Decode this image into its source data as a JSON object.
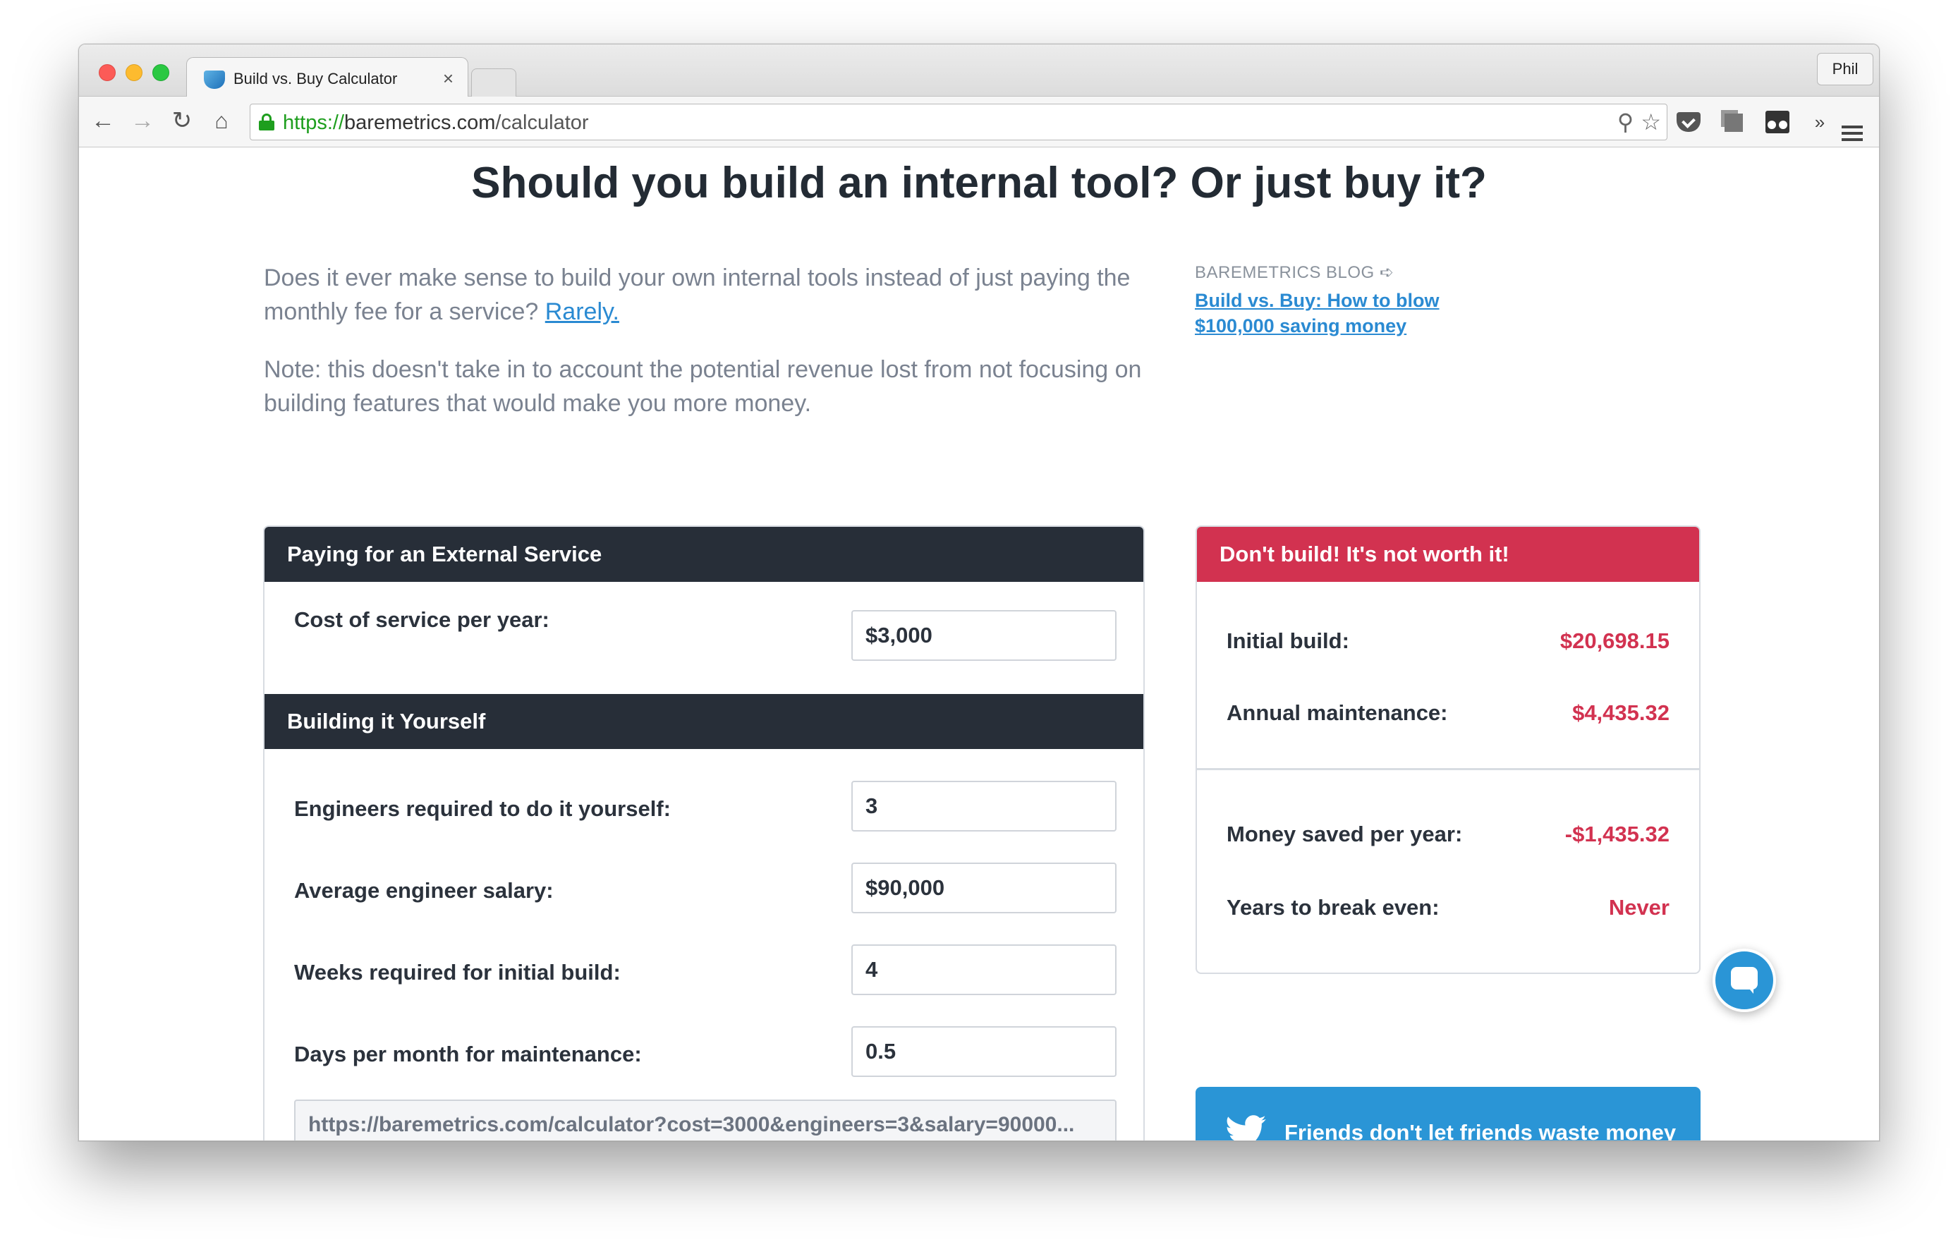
{
  "browser": {
    "tab_title": "Build vs. Buy Calculator",
    "tab_close": "×",
    "profile_name": "Phil",
    "url_scheme": "https://",
    "url_host": "baremetrics.com",
    "url_path": "/calculator"
  },
  "page": {
    "title": "Should you build an internal tool? Or just buy it?",
    "intro_text": "Does it ever make sense to build your own internal tools instead of just paying the monthly fee for a service?",
    "intro_link": "Rarely.",
    "note": "Note: this doesn't take in to account the potential revenue lost from not focusing on building features that would make you more money.",
    "blog_eyebrow": "BAREMETRICS BLOG ➪",
    "blog_link": "Build vs. Buy: How to blow $100,000 saving money"
  },
  "external": {
    "heading": "Paying for an External Service",
    "cost_label": "Cost of service per year:",
    "cost_value": "$3,000"
  },
  "build": {
    "heading": "Building it Yourself",
    "engineers_label": "Engineers required to do it yourself:",
    "engineers_value": "3",
    "salary_label": "Average engineer salary:",
    "salary_value": "$90,000",
    "weeks_label": "Weeks required for initial build:",
    "weeks_value": "4",
    "days_label": "Days per month for maintenance:",
    "days_value": "0.5",
    "share_url": "https://baremetrics.com/calculator?cost=3000&engineers=3&salary=90000..."
  },
  "result": {
    "heading": "Don't build! It's not worth it!",
    "initial_label": "Initial build:",
    "initial_value": "$20,698.15",
    "annual_label": "Annual maintenance:",
    "annual_value": "$4,435.32",
    "saved_label": "Money saved per year:",
    "saved_value": "-$1,435.32",
    "breakeven_label": "Years to break even:",
    "breakeven_value": "Never"
  },
  "tweet": {
    "label": "Friends don't let friends waste money"
  },
  "colors": {
    "dark_header": "#272e38",
    "alert_red": "#d23250",
    "accent_blue": "#2a95d6"
  }
}
